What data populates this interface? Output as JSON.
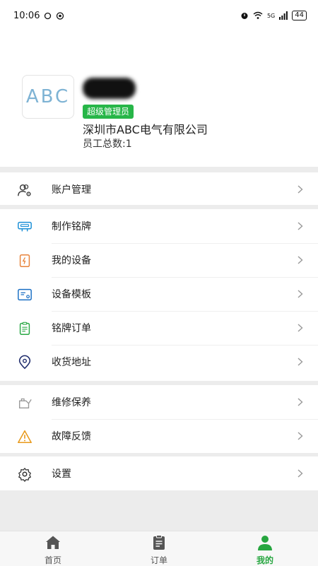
{
  "status_bar": {
    "time": "10:06",
    "network": "5G",
    "battery": "44"
  },
  "profile": {
    "logo_text": "ABC",
    "role": "超级管理员",
    "company": "深圳市ABC电气有限公司",
    "staff_count": "员工总数:1"
  },
  "menu": {
    "account": "账户管理",
    "make_nameplate": "制作铭牌",
    "my_devices": "我的设备",
    "device_template": "设备模板",
    "nameplate_orders": "铭牌订单",
    "shipping_address": "收货地址",
    "maintenance": "维修保养",
    "fault_feedback": "故障反馈",
    "settings": "设置"
  },
  "tabs": {
    "home": "首页",
    "orders": "订单",
    "mine": "我的"
  },
  "colors": {
    "accent": "#27b648",
    "separator": "#ececec"
  }
}
